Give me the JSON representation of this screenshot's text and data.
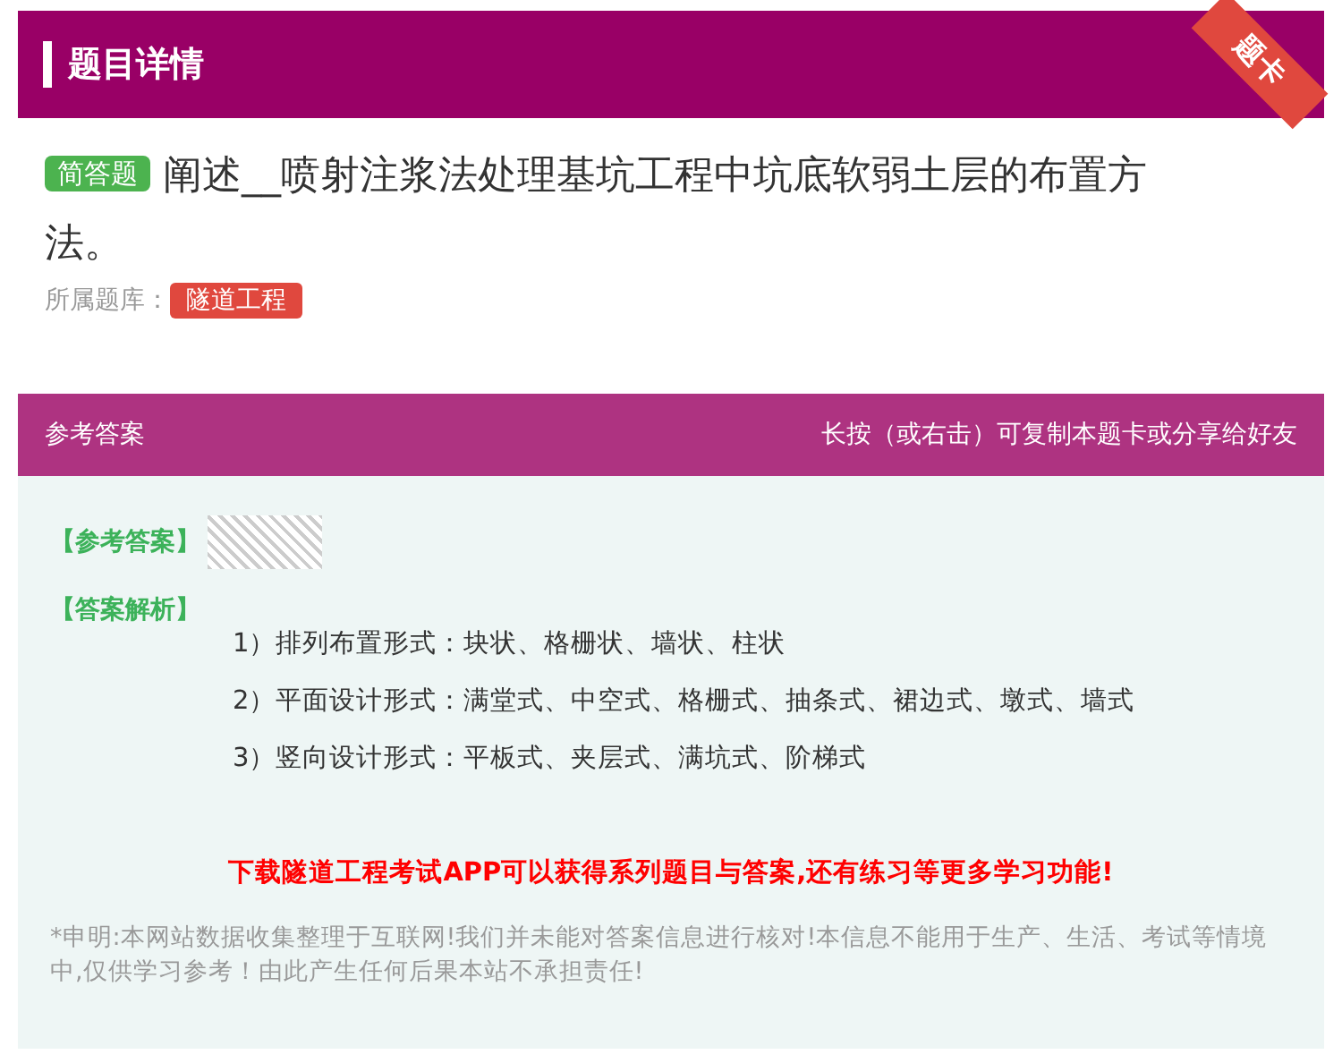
{
  "header": {
    "title": "题目详情",
    "ribbon": "题卡"
  },
  "question": {
    "type_badge": "简答题",
    "text": "阐述__喷射注浆法处理基坑工程中坑底软弱土层的布置方法。",
    "bank_label": "所属题库：",
    "bank": "隧道工程"
  },
  "answer": {
    "title": "参考答案",
    "hint": "长按（或右击）可复制本题卡或分享给好友",
    "answer_label": "【参考答案】",
    "analysis_label": "【答案解析】",
    "analysis_lines": [
      "1）排列布置形式：块状、格栅状、墙状、柱状",
      "2）平面设计形式：满堂式、中空式、格栅式、抽条式、裙边式、墩式、墙式",
      "3）竖向设计形式：平板式、夹层式、满坑式、阶梯式"
    ],
    "promo": "下载隧道工程考试APP可以获得系列题目与答案,还有练习等更多学习功能!",
    "disclaimer": "*申明:本网站数据收集整理于互联网!我们并未能对答案信息进行核对!本信息不能用于生产、生活、考试等情境中,仅供学习参考！由此产生任何后果本站不承担责任!"
  }
}
